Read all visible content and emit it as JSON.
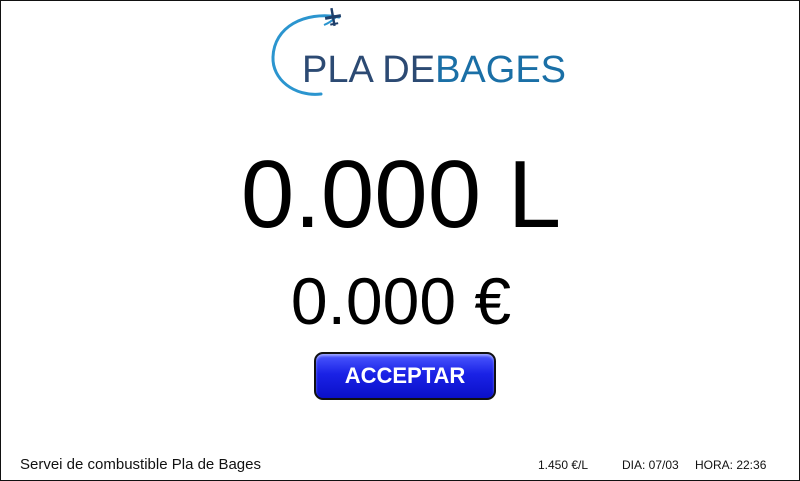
{
  "brand": {
    "name_part1": "PLA DE",
    "name_part2": "BAGES",
    "icon": "airplane-orbit-logo",
    "colors": {
      "navy": "#1e3f6b",
      "blue": "#1a6fa6",
      "arc": "#2b95cf"
    }
  },
  "display": {
    "liters": "0.000 L",
    "amount": "0.000 €"
  },
  "actions": {
    "accept_label": "ACCEPTAR",
    "button_color": "#1a22e6"
  },
  "footer": {
    "service_name": "Servei de combustible Pla de Bages",
    "price": "1.450 €/L",
    "date": "DIA: 07/03",
    "time": "HORA: 22:36"
  }
}
